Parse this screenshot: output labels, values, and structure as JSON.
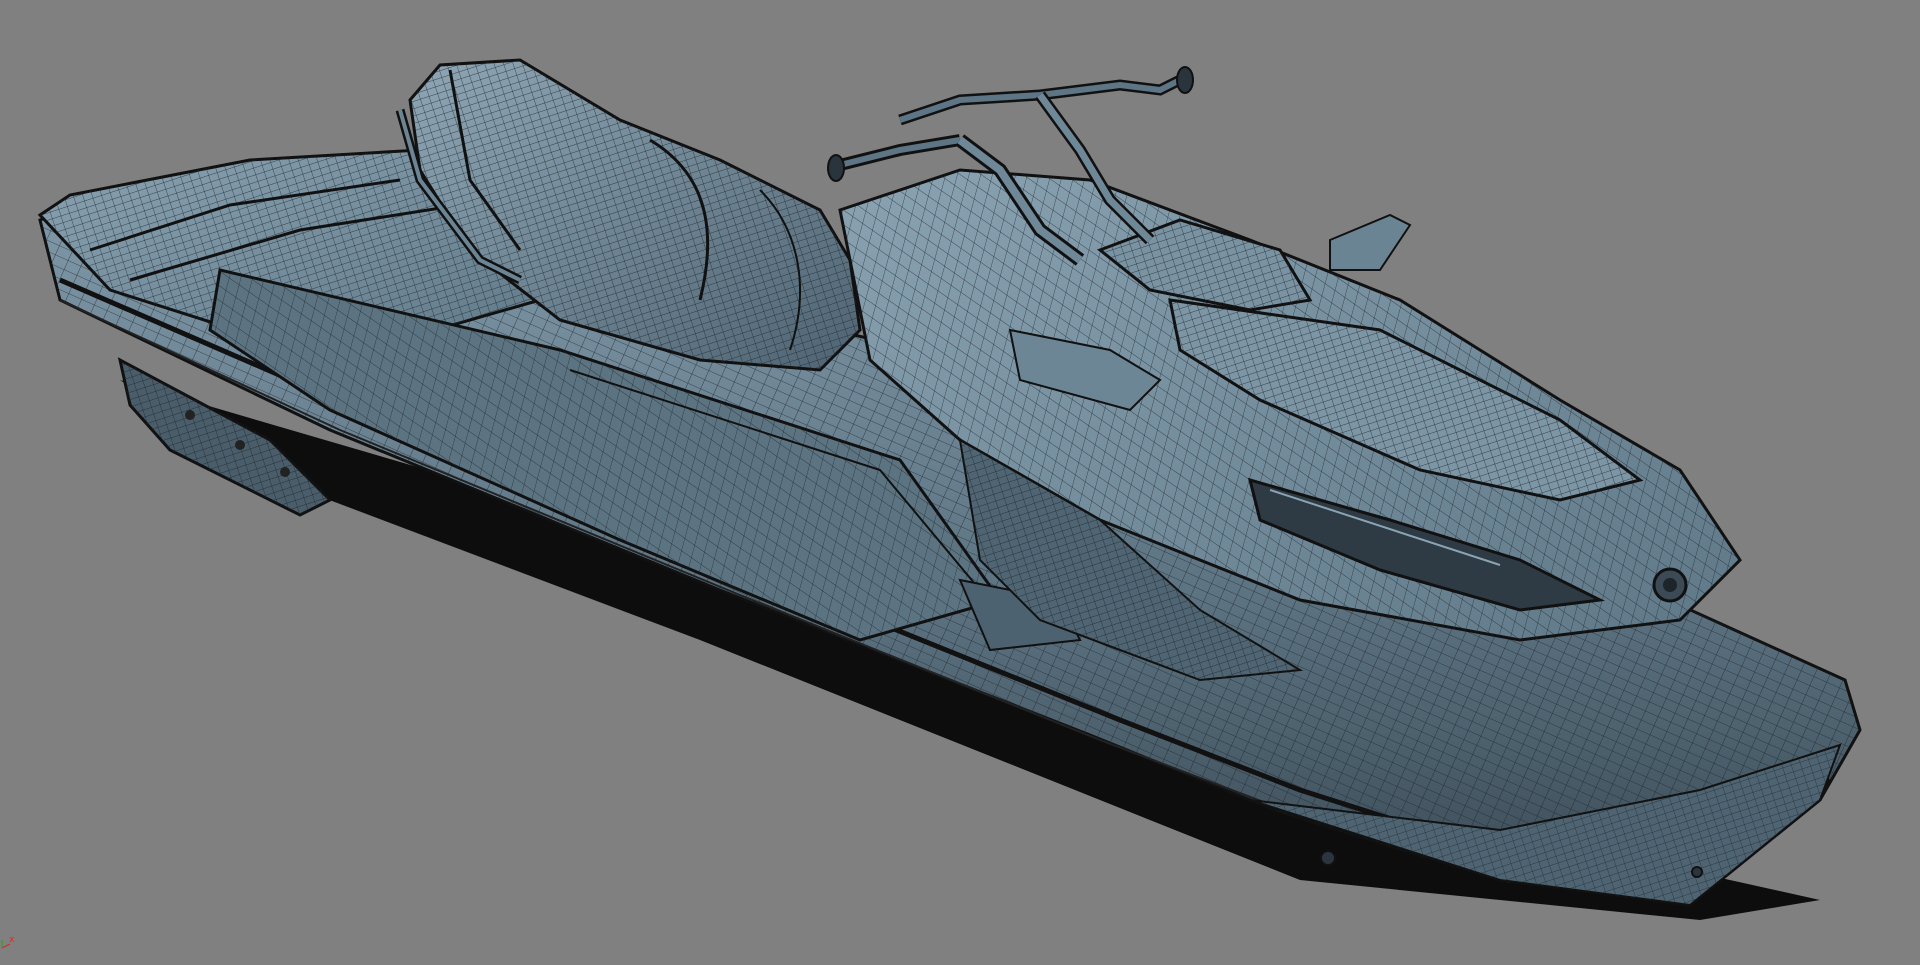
{
  "viewport": {
    "background_color": "#808080",
    "model_fill_color": "#6b8494",
    "wire_color": "#1a1d20",
    "shadow_color": "#000000",
    "subject": "jet-ski-wireframe-model"
  },
  "axis_gizmo": {
    "x_label": "x",
    "x_color": "#d03020",
    "y_color": "#30a030"
  }
}
